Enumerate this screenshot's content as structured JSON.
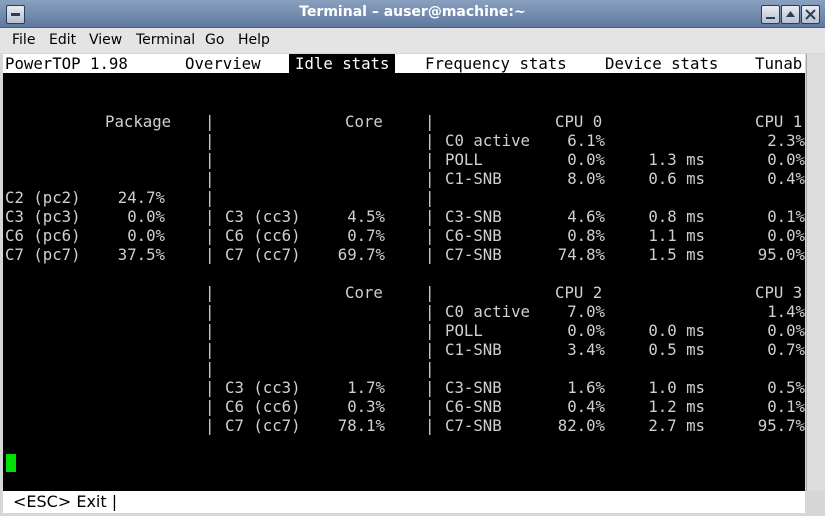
{
  "window": {
    "title": "Terminal – auser@machine:~"
  },
  "menubar": {
    "items": [
      "File",
      "Edit",
      "View",
      "Terminal",
      "Go",
      "Help"
    ]
  },
  "powertop": {
    "app_name": "PowerTOP 1.98",
    "tabs": [
      "Overview",
      "Idle stats",
      "Frequency stats",
      "Device stats",
      "Tunab"
    ],
    "active_tab": "Idle stats"
  },
  "section1": {
    "package_header": "Package",
    "core_header": "Core",
    "cpu_a_header": "CPU 0",
    "cpu_b_header": "CPU 1",
    "package_rows": [
      {
        "state": "C2 (pc2)",
        "pct": "24.7%"
      },
      {
        "state": "C3 (pc3)",
        "pct": "0.0%"
      },
      {
        "state": "C6 (pc6)",
        "pct": "0.0%"
      },
      {
        "state": "C7 (pc7)",
        "pct": "37.5%"
      }
    ],
    "core_rows": [
      {
        "state": "C3 (cc3)",
        "pct": "4.5%"
      },
      {
        "state": "C6 (cc6)",
        "pct": "0.7%"
      },
      {
        "state": "C7 (cc7)",
        "pct": "69.7%"
      }
    ],
    "cpu_rows": [
      {
        "state": "C0 active",
        "pct_a": "6.1%",
        "time": "",
        "pct_b": "2.3%"
      },
      {
        "state": "POLL",
        "pct_a": "0.0%",
        "time": "1.3 ms",
        "pct_b": "0.0%"
      },
      {
        "state": "C1-SNB",
        "pct_a": "8.0%",
        "time": "0.6 ms",
        "pct_b": "0.4%"
      },
      {
        "state": "C3-SNB",
        "pct_a": "4.6%",
        "time": "0.8 ms",
        "pct_b": "0.1%"
      },
      {
        "state": "C6-SNB",
        "pct_a": "0.8%",
        "time": "1.1 ms",
        "pct_b": "0.0%"
      },
      {
        "state": "C7-SNB",
        "pct_a": "74.8%",
        "time": "1.5 ms",
        "pct_b": "95.0%"
      }
    ]
  },
  "section2": {
    "core_header": "Core",
    "cpu_a_header": "CPU 2",
    "cpu_b_header": "CPU 3",
    "core_rows": [
      {
        "state": "C3 (cc3)",
        "pct": "1.7%"
      },
      {
        "state": "C6 (cc6)",
        "pct": "0.3%"
      },
      {
        "state": "C7 (cc7)",
        "pct": "78.1%"
      }
    ],
    "cpu_rows": [
      {
        "state": "C0 active",
        "pct_a": "7.0%",
        "time": "",
        "pct_b": "1.4%"
      },
      {
        "state": "POLL",
        "pct_a": "0.0%",
        "time": "0.0 ms",
        "pct_b": "0.0%"
      },
      {
        "state": "C1-SNB",
        "pct_a": "3.4%",
        "time": "0.5 ms",
        "pct_b": "0.7%"
      },
      {
        "state": "C3-SNB",
        "pct_a": "1.6%",
        "time": "1.0 ms",
        "pct_b": "0.5%"
      },
      {
        "state": "C6-SNB",
        "pct_a": "0.4%",
        "time": "1.2 ms",
        "pct_b": "0.1%"
      },
      {
        "state": "C7-SNB",
        "pct_a": "82.0%",
        "time": "2.7 ms",
        "pct_b": "95.7%"
      }
    ]
  },
  "footer": {
    "esc_hint": "<ESC> Exit |"
  },
  "colors": {
    "cursor": "#00e000",
    "terminal_bg": "#000000",
    "terminal_fg": "#d0d0d0"
  }
}
